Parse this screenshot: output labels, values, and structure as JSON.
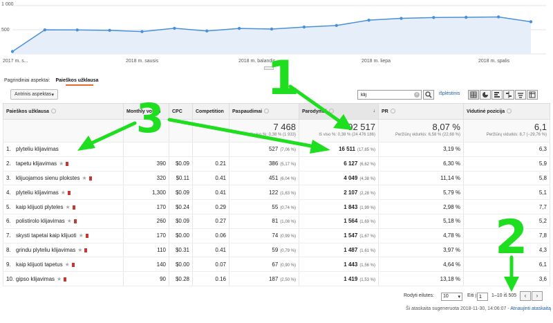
{
  "chart": {
    "y_ticks": [
      "1 000",
      "500"
    ],
    "x_labels": [
      "2017 m. s...",
      "2018 m. sausis",
      "2018 m. balandis",
      "2018 m. liepa",
      "2018 m. spalis"
    ],
    "line_color": "#4a90d9",
    "fill_color": "#e6eefa"
  },
  "chart_data": {
    "type": "area",
    "x": [
      "2017 m. s...",
      "",
      "",
      "",
      "2018 m. sausis",
      "",
      "",
      "2018 m. balandis",
      "",
      "",
      "2018 m. liepa",
      "",
      "",
      "2018 m. spalis",
      ""
    ],
    "series": [
      {
        "values": [
          50,
          498,
          496,
          488,
          462,
          530,
          475,
          527,
          515,
          556,
          588,
          698,
          735,
          752,
          757,
          765,
          665
        ]
      }
    ],
    "ylim": [
      0,
      1000
    ],
    "grid": true
  },
  "dimensions": {
    "label": "Pagrindiniai aspektai:",
    "active": "Paieškos užklausa"
  },
  "toolbar": {
    "secondary_dimension": "Antrinis aspektas",
    "search_value": "klij",
    "advanced_link": "išplėstinis",
    "view_icons": [
      "table-view-icon",
      "pie-view-icon",
      "performance-view-icon",
      "comparison-view-icon",
      "term-cloud-view-icon",
      "pivot-view-icon"
    ]
  },
  "table": {
    "columns": [
      "Paieškos užklausa",
      "Monthly volum",
      "CPC",
      "Competition",
      "Paspaudimai",
      "Parodymai",
      "PR",
      "Vidutinė pozicija"
    ],
    "totals": {
      "clicks": "7 468",
      "clicks_sub": "Iš viso %: 0,38 % (1 933)",
      "impressions": "92 517",
      "impressions_sub": "Iš viso %: 0,38 % (24 476 186)",
      "ctr": "8,07 %",
      "ctr_sub": "Peržiūrų vidurkis: 6,58 % (22,68 %)",
      "position": "6,1",
      "position_sub": "Peržiūrų vidurkis: 8,7 (−29,76 %)"
    },
    "rows": [
      {
        "num": "1.",
        "query": "plyteliu klijavimas",
        "volume": "",
        "cpc": "",
        "competition": "",
        "clicks": "527",
        "clicks_pct": "(7,06 %)",
        "impressions": "16 511",
        "impressions_pct": "(17,85 %)",
        "ctr": "3,19 %",
        "position": "6,3",
        "icons": false
      },
      {
        "num": "2.",
        "query": "tapetu klijavimas",
        "volume": "390",
        "cpc": "$0.09",
        "competition": "0.21",
        "clicks": "386",
        "clicks_pct": "(5,17 %)",
        "impressions": "6 127",
        "impressions_pct": "(6,62 %)",
        "ctr": "6,30 %",
        "position": "5,9",
        "icons": true
      },
      {
        "num": "3.",
        "query": "klijuojamos sienu plokstes",
        "volume": "320",
        "cpc": "$0.11",
        "competition": "0.41",
        "clicks": "451",
        "clicks_pct": "(6,04 %)",
        "impressions": "4 049",
        "impressions_pct": "(4,38 %)",
        "ctr": "11,14 %",
        "position": "5,8",
        "icons": true
      },
      {
        "num": "4.",
        "query": "plyteliu klijavimas",
        "volume": "1,300",
        "cpc": "$0.09",
        "competition": "0.41",
        "clicks": "122",
        "clicks_pct": "(1,63 %)",
        "impressions": "2 107",
        "impressions_pct": "(2,28 %)",
        "ctr": "5,79 %",
        "position": "5,1",
        "icons": true
      },
      {
        "num": "5.",
        "query": "kaip klijuoti plyteles",
        "volume": "170",
        "cpc": "$0.24",
        "competition": "0.29",
        "clicks": "55",
        "clicks_pct": "(0,74 %)",
        "impressions": "1 843",
        "impressions_pct": "(1,99 %)",
        "ctr": "2,98 %",
        "position": "7,7",
        "icons": true
      },
      {
        "num": "6.",
        "query": "polistirolo klijavimas",
        "volume": "260",
        "cpc": "$0.09",
        "competition": "0.27",
        "clicks": "81",
        "clicks_pct": "(1,08 %)",
        "impressions": "1 564",
        "impressions_pct": "(1,69 %)",
        "ctr": "5,18 %",
        "position": "5,2",
        "icons": true
      },
      {
        "num": "7.",
        "query": "skysti tapetai kaip klijuoti",
        "volume": "170",
        "cpc": "$0.00",
        "competition": "0.06",
        "clicks": "74",
        "clicks_pct": "(0,99 %)",
        "impressions": "1 547",
        "impressions_pct": "(1,67 %)",
        "ctr": "4,78 %",
        "position": "7,8",
        "icons": true
      },
      {
        "num": "8.",
        "query": "grindu plyteliu klijavimas",
        "volume": "110",
        "cpc": "$0.31",
        "competition": "0.41",
        "clicks": "59",
        "clicks_pct": "(0,79 %)",
        "impressions": "1 487",
        "impressions_pct": "(1,61 %)",
        "ctr": "3,97 %",
        "position": "4,3",
        "icons": true
      },
      {
        "num": "9.",
        "query": "kaip klijuoti tapetus",
        "volume": "140",
        "cpc": "$0.00",
        "competition": "0.07",
        "clicks": "67",
        "clicks_pct": "(0,90 %)",
        "impressions": "1 443",
        "impressions_pct": "(1,56 %)",
        "ctr": "4,64 %",
        "position": "6,1",
        "icons": true
      },
      {
        "num": "10.",
        "query": "gipso klijavimas",
        "volume": "90",
        "cpc": "$0.28",
        "competition": "0.16",
        "clicks": "187",
        "clicks_pct": "(2,50 %)",
        "impressions": "1 419",
        "impressions_pct": "(1,53 %)",
        "ctr": "13,18 %",
        "position": "3,6",
        "icons": true
      }
    ]
  },
  "footer": {
    "rows_label": "Rodyti eilutes:",
    "rows_value": "10",
    "goto_label": "Eiti į:",
    "goto_value": "1",
    "range": "1–10 iš 505",
    "prev": "‹",
    "next": "›",
    "report_text": "Ši ataskaita sugeneruota 2018-11-30, 14:06:07 -",
    "refresh_link": "Atnaujinti ataskaitą"
  },
  "annotations": {
    "labels": [
      "1",
      "2",
      "3"
    ],
    "color": "#1fdd1f"
  }
}
